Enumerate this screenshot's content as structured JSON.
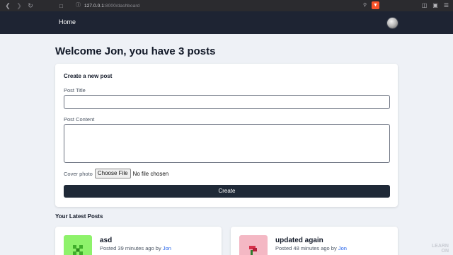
{
  "browser": {
    "url_host": "127.0.0.1",
    "url_rest": ":8000/dashboard"
  },
  "nav": {
    "home_label": "Home"
  },
  "page": {
    "title": "Welcome Jon, you have 3 posts"
  },
  "create_post": {
    "heading": "Create a new post",
    "title_label": "Post Title",
    "title_value": "",
    "content_label": "Post Content",
    "content_value": "",
    "cover_label": "Cover photo",
    "file_button": "Choose File",
    "file_status": "No file chosen",
    "submit_label": "Create"
  },
  "latest": {
    "heading": "Your Latest Posts",
    "posts": [
      {
        "title": "asd",
        "meta": "Posted 39 minutes ago by",
        "author": "Jon",
        "thumb_color": "#8ef26b"
      },
      {
        "title": "updated again",
        "meta": "Posted 48 minutes ago by",
        "author": "Jon",
        "thumb_color": "#f4b8c4"
      }
    ]
  },
  "watermark": {
    "line1": "LEARN",
    "line2": "ON"
  }
}
